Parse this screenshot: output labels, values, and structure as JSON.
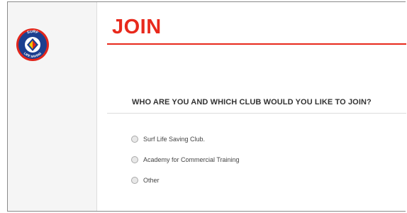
{
  "brand": {
    "logo_icon": "surf-life-saving-logo",
    "logo_text_top": "SURF",
    "logo_text_bottom": "LIFE SAVING"
  },
  "page": {
    "title": "JOIN",
    "question": "WHO ARE YOU AND WHICH CLUB WOULD YOU LIKE TO JOIN?"
  },
  "options": [
    {
      "label": "Surf Life Saving Club.",
      "selected": false
    },
    {
      "label": "Academy for Commercial Training",
      "selected": false
    },
    {
      "label": "Other",
      "selected": false
    }
  ],
  "colors": {
    "accent": "#e8291c",
    "logo_blue": "#1b3f8f",
    "logo_red": "#e1261c",
    "logo_yellow": "#f6c700"
  }
}
